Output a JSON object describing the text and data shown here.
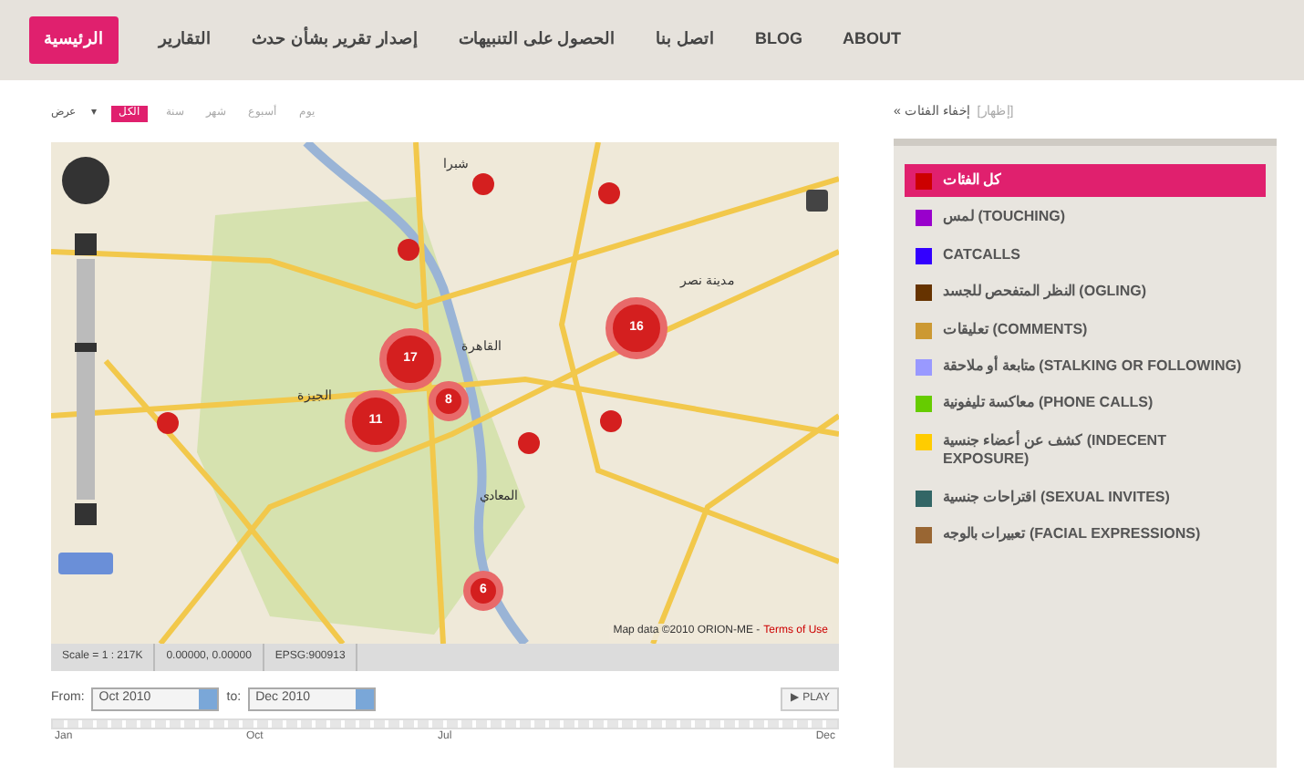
{
  "nav": [
    {
      "label": "ABOUT",
      "selected": false
    },
    {
      "label": "BLOG",
      "selected": false
    },
    {
      "label": "اتصل بنا",
      "selected": false
    },
    {
      "label": "الحصول على التنبيهات",
      "selected": false
    },
    {
      "label": "إصدار تقرير بشأن حدث",
      "selected": false
    },
    {
      "label": "التقارير",
      "selected": false
    },
    {
      "label": "الرئيسية",
      "selected": true
    }
  ],
  "filters": {
    "label": "عرض",
    "caret": "▾",
    "options": [
      {
        "label": "يوم",
        "selected": false
      },
      {
        "label": "أسبوع",
        "selected": false
      },
      {
        "label": "شهر",
        "selected": false
      },
      {
        "label": "سنة",
        "selected": false
      },
      {
        "label": "الكل",
        "selected": true
      }
    ]
  },
  "map": {
    "markers": [
      {
        "kind": "point"
      },
      {
        "kind": "point"
      },
      {
        "kind": "point"
      },
      {
        "kind": "point"
      },
      {
        "kind": "point"
      },
      {
        "kind": "point"
      },
      {
        "kind": "cluster",
        "label": "17"
      },
      {
        "kind": "cluster",
        "label": "11"
      },
      {
        "kind": "cluster",
        "label": "8"
      },
      {
        "kind": "cluster",
        "label": "16"
      },
      {
        "kind": "cluster",
        "label": "6"
      }
    ],
    "zoom": {
      "level": 0.65
    },
    "place_labels": [
      "القاهرة",
      "الجيزة",
      "شبرا",
      "مدينة نصر",
      "المعادي"
    ],
    "attribution": "Map data ©2010 ORION-ME -",
    "terms": "Terms of Use",
    "status": [
      "EPSG:900913",
      "0.00000, 0.00000",
      "Scale = 1 : 217K"
    ]
  },
  "timeline": {
    "from_label": "From:",
    "from": "Oct 2010",
    "to_label": "to:",
    "to": "Dec 2010",
    "play": "▶ PLAY",
    "level": 1,
    "ticks": [
      "Dec",
      "Jul",
      "Oct",
      "Jan"
    ]
  },
  "sidebar": {
    "hide": "« إخفاء الفئات",
    "show": "[إظهار]",
    "categories": [
      {
        "label": "كل الفئات",
        "color": "#cc0000",
        "selected": true
      },
      {
        "label": "لمس (TOUCHING)",
        "color": "#9900cc",
        "selected": false
      },
      {
        "label": "CATCALLS",
        "color": "#3300ff",
        "selected": false
      },
      {
        "label": "النظر المتفحص للجسد (OGLING)",
        "color": "#663300",
        "selected": false
      },
      {
        "label": "تعليقات (COMMENTS)",
        "color": "#cc9933",
        "selected": false
      },
      {
        "label": "متابعة أو ملاحقة (STALKING OR FOLLOWING)",
        "color": "#9999ff",
        "selected": false
      },
      {
        "label": "معاكسة تليفونية (PHONE CALLS)",
        "color": "#66cc00",
        "selected": false
      },
      {
        "label": "كشف عن أعضاء جنسية (INDECENT EXPOSURE)",
        "color": "#ffcc00",
        "selected": false
      },
      {
        "label": "اقتراحات جنسية (SEXUAL INVITES)",
        "color": "#336666",
        "selected": false
      },
      {
        "label": "تعبيرات بالوجه (FACIAL EXPRESSIONS)",
        "color": "#996633",
        "selected": false
      }
    ]
  }
}
